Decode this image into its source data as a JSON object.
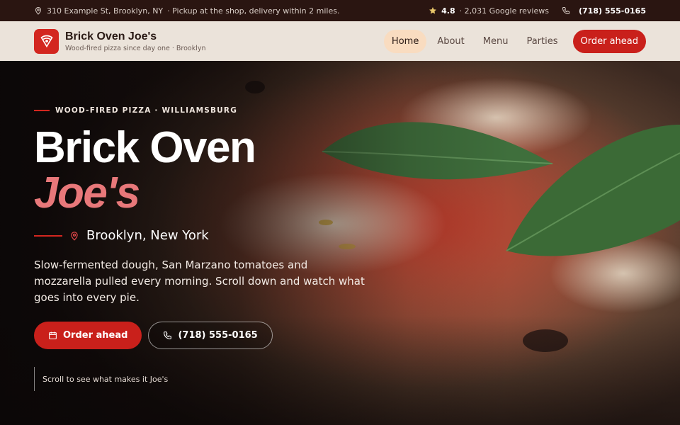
{
  "topbar": {
    "address": "310 Example St, Brooklyn, NY",
    "pickup_note": "· Pickup at the shop, delivery within 2 miles.",
    "rating": "4.8",
    "reviews": "· 2,031 Google reviews",
    "phone": "(718) 555-0165"
  },
  "header": {
    "brand_name": "Brick Oven Joe's",
    "brand_tagline": "Wood-fired pizza since day one · Brooklyn",
    "nav": [
      "Home",
      "About",
      "Menu",
      "Parties"
    ],
    "active_nav": "Home",
    "cta_label": "Order ahead"
  },
  "hero": {
    "eyebrow": "WOOD-FIRED PIZZA · WILLIAMSBURG",
    "title_line1": "Brick Oven",
    "title_line2": "Joe's",
    "location": "Brooklyn, New York",
    "description": "Slow-fermented dough, San Marzano tomatoes and mozzarella pulled every morning. Scroll down and watch what goes into every pie.",
    "primary_button": "Order ahead",
    "secondary_button": "(718) 555-0165",
    "scroll_hint": "Scroll to see what makes it Joe's"
  },
  "icons": {
    "address": "map-pin-icon",
    "rating": "star-icon",
    "phone": "phone-icon",
    "logo": "pizza-slice-icon",
    "order": "calendar-icon"
  },
  "colors": {
    "accent": "#c9201b",
    "title_highlight": "#e8787a",
    "topbar_bg": "#2a1511",
    "header_bg": "#ebe3da",
    "active_nav_bg": "#f9dcc0"
  }
}
